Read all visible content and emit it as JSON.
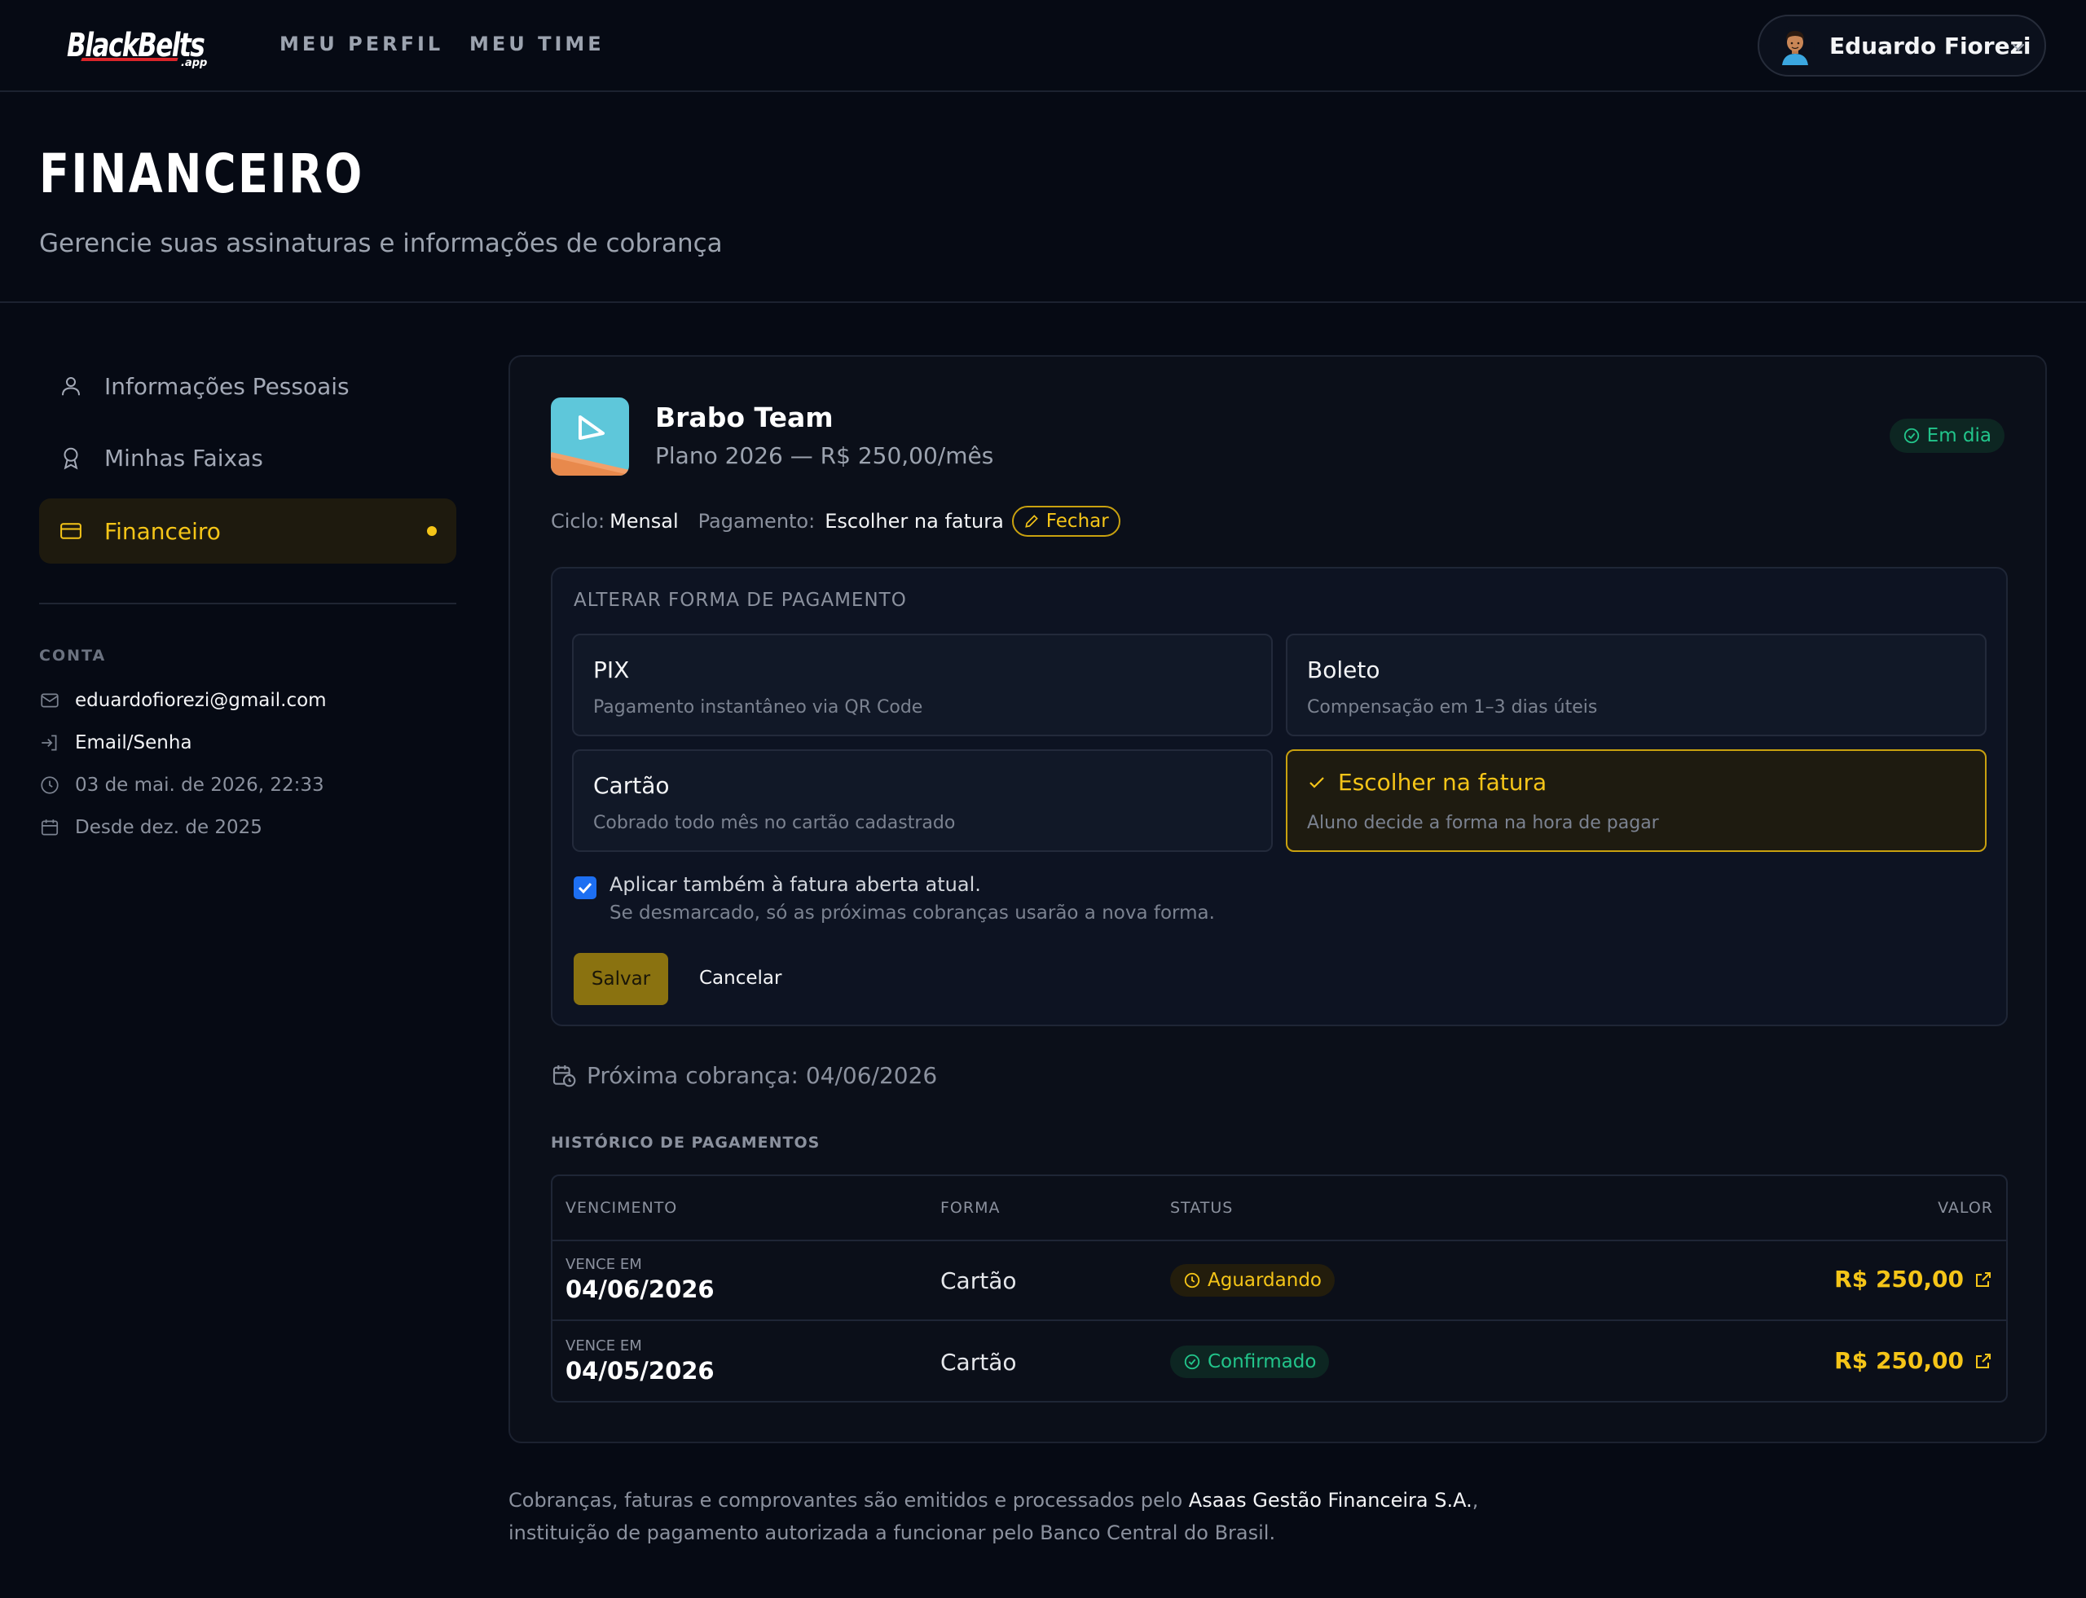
{
  "nav": {
    "logo_text": "BlackBelts",
    "logo_suffix": ".app",
    "links": [
      "MEU PERFIL",
      "MEU TIME"
    ],
    "user_name": "Eduardo Fiorezi"
  },
  "page": {
    "title": "FINANCEIRO",
    "subtitle": "Gerencie suas assinaturas e informações de cobrança"
  },
  "sidebar": {
    "items": [
      {
        "label": "Informações Pessoais",
        "icon": "user-icon"
      },
      {
        "label": "Minhas Faixas",
        "icon": "award-icon"
      },
      {
        "label": "Financeiro",
        "icon": "credit-card-icon",
        "active": true
      }
    ],
    "account_label": "CONTA",
    "account": [
      {
        "icon": "mail-icon",
        "text": "eduardofiorezi@gmail.com"
      },
      {
        "icon": "login-icon",
        "text": "Email/Senha"
      },
      {
        "icon": "clock-icon",
        "text": "03 de mai. de 2026, 22:33"
      },
      {
        "icon": "calendar-icon",
        "text": "Desde dez. de 2025"
      }
    ]
  },
  "subscription": {
    "team_name": "Brabo Team",
    "plan": "Plano 2026 — R$ 250,00/mês",
    "status": "Em dia",
    "cycle_label": "Ciclo:",
    "cycle_value": "Mensal",
    "payment_label": "Pagamento:",
    "payment_value": "Escolher na fatura",
    "close_button": "Fechar"
  },
  "payment_panel": {
    "title": "ALTERAR FORMA DE PAGAMENTO",
    "options": [
      {
        "title": "PIX",
        "desc": "Pagamento instantâneo via QR Code"
      },
      {
        "title": "Boleto",
        "desc": "Compensação em 1–3 dias úteis"
      },
      {
        "title": "Cartão",
        "desc": "Cobrado todo mês no cartão cadastrado"
      },
      {
        "title": "Escolher na fatura",
        "desc": "Aluno decide a forma na hora de pagar",
        "selected": true
      }
    ],
    "apply_label": "Aplicar também à fatura aberta atual.",
    "apply_hint": "Se desmarcado, só as próximas cobranças usarão a nova forma.",
    "save": "Salvar",
    "cancel": "Cancelar"
  },
  "next_charge": "Próxima cobrança: 04/06/2026",
  "history": {
    "title": "HISTÓRICO DE PAGAMENTOS",
    "columns": [
      "VENCIMENTO",
      "FORMA",
      "STATUS",
      "VALOR"
    ],
    "rows": [
      {
        "due_label": "VENCE EM",
        "due": "04/06/2026",
        "method": "Cartão",
        "status": "Aguardando",
        "value": "R$ 250,00"
      },
      {
        "due_label": "VENCE EM",
        "due": "04/05/2026",
        "method": "Cartão",
        "status": "Confirmado",
        "value": "R$ 250,00"
      }
    ]
  },
  "footer": {
    "text_before": "Cobranças, faturas e comprovantes são emitidos e processados pelo ",
    "company": "Asaas Gestão Financeira S.A.",
    "text_after": ", instituição de pagamento autorizada a funcionar pelo Banco Central do Brasil."
  },
  "colors": {
    "background": "#060a14",
    "accent": "#f5c518",
    "success": "#22c58b",
    "checkbox": "#1d6ff2"
  }
}
